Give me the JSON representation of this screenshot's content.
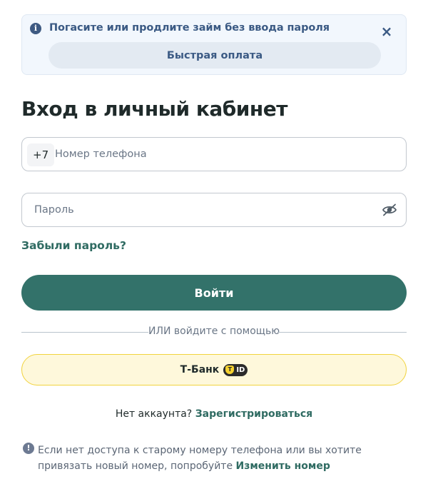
{
  "banner": {
    "text": "Погасите или продлите займ без ввода пароля",
    "close_icon": "close-icon",
    "quick_pay_label": "Быстрая оплата"
  },
  "title": "Вход в личный кабинет",
  "phone": {
    "prefix": "+7",
    "value": "",
    "placeholder": "Номер телефона"
  },
  "password": {
    "value": "",
    "placeholder": "Пароль",
    "toggle_icon": "eye-off-icon"
  },
  "forgot_label": "Забыли пароль?",
  "login_label": "Войти",
  "divider_text": "ИЛИ войдите с помощью",
  "tbank": {
    "label": "Т-Банк",
    "badge_text": "ID"
  },
  "register": {
    "prompt": "Нет аккаунта?",
    "link": "Зарегистрироваться"
  },
  "notice": {
    "text": "Если нет доступа к старому номеру телефона или вы хотите привязать новый номер, попробуйте",
    "link": "Изменить номер"
  },
  "colors": {
    "accent": "#33726a",
    "banner_bg": "#f2f7fd",
    "banner_text": "#3b5a84",
    "tbank_bg": "#fef8db",
    "tbank_border": "#f1d33e"
  }
}
